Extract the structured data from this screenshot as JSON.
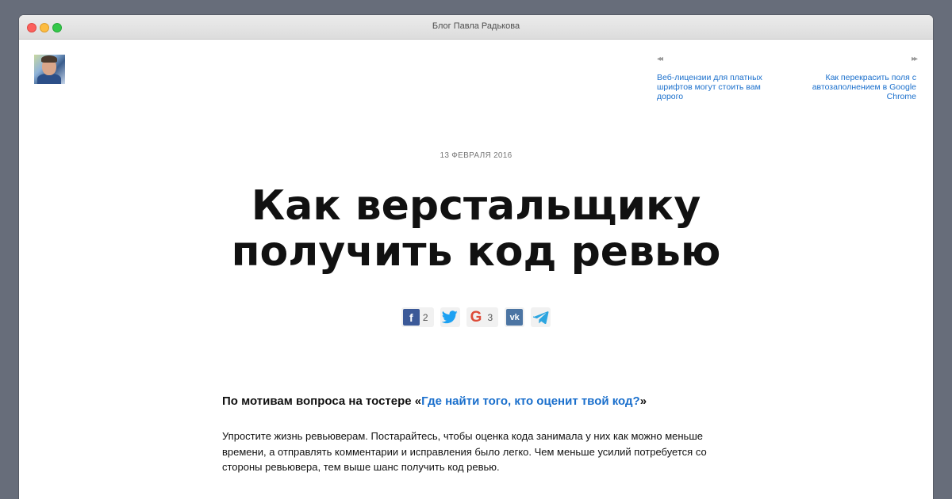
{
  "window": {
    "title": "Блог Павла Радькова"
  },
  "nav": {
    "prev": {
      "arrow": "◂◂",
      "label": "Веб-лицензии для платных шрифтов могут стоить вам дорого"
    },
    "next": {
      "arrow": "▸▸",
      "label": "Как перекрасить поля с автозаполнением в Google Chrome"
    }
  },
  "article": {
    "date": "13 ФЕВРАЛЯ 2016",
    "title": "Как верстальщику получить код ревью",
    "lede_prefix": "По мотивам вопроса на тостере «",
    "lede_link": "Где найти того, кто оценит твой код?",
    "lede_suffix": "»",
    "paragraph": "Упростите жизнь ревьюверам. Постарайтесь, чтобы оценка кода занимала у них как можно меньше времени, а отправлять комментарии и исправления было легко. Чем меньше усилий потребуется со стороны ревьювера, тем выше шанс получить код ревью."
  },
  "share": {
    "facebook": {
      "icon": "facebook-icon",
      "glyph": "f",
      "color": "#3b5998",
      "count": "2"
    },
    "twitter": {
      "icon": "twitter-icon",
      "color": "#1da1f2"
    },
    "google": {
      "icon": "google-icon",
      "glyph": "G",
      "color": "#dd4b39",
      "count": "3"
    },
    "vk": {
      "icon": "vk-icon",
      "glyph": "vk",
      "color": "#4c75a3"
    },
    "telegram": {
      "icon": "telegram-icon",
      "color": "#2ca5e0"
    }
  }
}
